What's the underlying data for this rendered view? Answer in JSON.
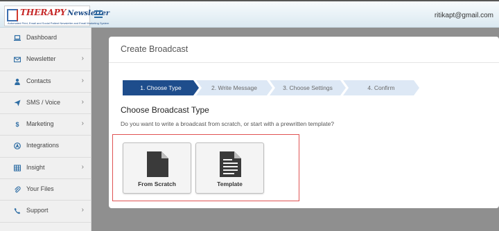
{
  "header": {
    "logo_title": "THERAPY",
    "logo_subtitle": "Newsletter",
    "logo_tagline": "Automated Print, Email and Social Patient Newsletter and Email Marketing System",
    "menu_icon": "hamburger-icon",
    "user_email": "ritikapt@gmail.com"
  },
  "sidebar": {
    "items": [
      {
        "label": "Dashboard",
        "icon": "laptop-icon"
      },
      {
        "label": "Newsletter",
        "icon": "envelope-icon"
      },
      {
        "label": "Contacts",
        "icon": "user-icon"
      },
      {
        "label": "SMS / Voice",
        "icon": "send-icon"
      },
      {
        "label": "Marketing",
        "icon": "dollar-icon"
      },
      {
        "label": "Integrations",
        "icon": "connect-icon"
      },
      {
        "label": "Insight",
        "icon": "table-icon"
      },
      {
        "label": "Your Files",
        "icon": "paperclip-icon"
      },
      {
        "label": "Support",
        "icon": "phone-icon"
      }
    ]
  },
  "main": {
    "title": "Create Broadcast",
    "steps": [
      {
        "label": "1. Choose Type",
        "active": true
      },
      {
        "label": "2. Write Message",
        "active": false
      },
      {
        "label": "3. Choose Settings",
        "active": false
      },
      {
        "label": "4. Confirm",
        "active": false
      }
    ],
    "section_title": "Choose Broadcast Type",
    "section_subtitle": "Do you want to write a broadcast from scratch, or start with a prewritten template?",
    "options": [
      {
        "label": "From Scratch",
        "icon": "blank-file-icon"
      },
      {
        "label": "Template",
        "icon": "text-file-icon"
      }
    ]
  },
  "colors": {
    "active_step": "#1e4d8c",
    "inactive_step": "#dde8f5",
    "highlight_border": "#e05252",
    "sidebar_icon": "#2e6da4"
  }
}
